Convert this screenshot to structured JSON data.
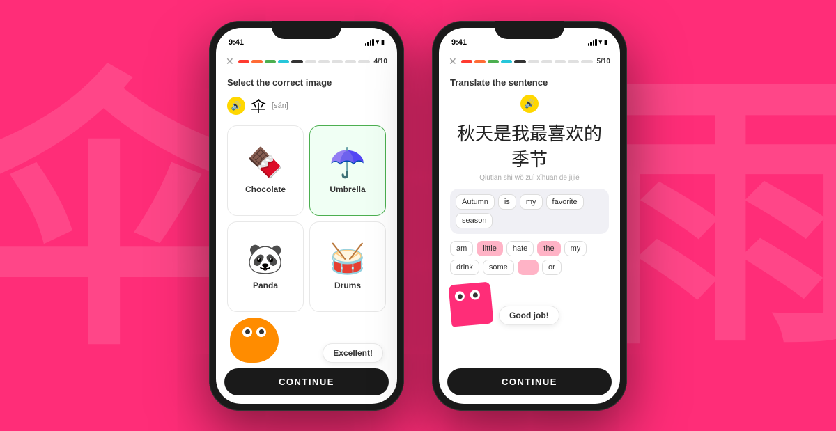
{
  "background": {
    "color": "#FF2D78",
    "bg_letters": [
      "伞",
      "雨"
    ]
  },
  "phone1": {
    "status": {
      "time": "9:41",
      "signal": "●●●",
      "wifi": "wifi",
      "battery": "battery"
    },
    "progress": {
      "filled": 5,
      "total": 10,
      "count": "4/10"
    },
    "close_label": "✕",
    "question": "Select the correct image",
    "word_display": "伞",
    "pinyin": "[sǎn]",
    "images": [
      {
        "emoji": "🍫",
        "label": "Chocolate",
        "selected": false
      },
      {
        "emoji": "☂️",
        "label": "Umbrella",
        "selected": true
      },
      {
        "emoji": "🐼",
        "label": "Panda",
        "selected": false
      },
      {
        "emoji": "🥁",
        "label": "Drums",
        "selected": false
      }
    ],
    "speech": "Excellent!",
    "continue_label": "CONTINUE"
  },
  "phone2": {
    "status": {
      "time": "9:41",
      "signal": "●●●",
      "wifi": "wifi",
      "battery": "battery"
    },
    "progress": {
      "filled": 5,
      "total": 10,
      "count": "5/10"
    },
    "close_label": "✕",
    "question": "Translate the sentence",
    "chinese_sentence": "秋天是我最喜欢的季节",
    "pinyin_sentence": "Qiūtiān shì wǒ zuì xǐhuān de jìjié",
    "answer_words": [
      "Autumn",
      "is",
      "my",
      "favorite",
      "season"
    ],
    "word_pool": [
      {
        "word": "am",
        "pink": false
      },
      {
        "word": "little",
        "pink": true
      },
      {
        "word": "hate",
        "pink": false
      },
      {
        "word": "the",
        "pink": true
      },
      {
        "word": "my",
        "pink": false
      },
      {
        "word": "drink",
        "pink": false
      },
      {
        "word": "some",
        "pink": false
      },
      {
        "word": "or",
        "pink": false
      }
    ],
    "good_job_label": "Good job!",
    "continue_label": "CONTINUE"
  }
}
